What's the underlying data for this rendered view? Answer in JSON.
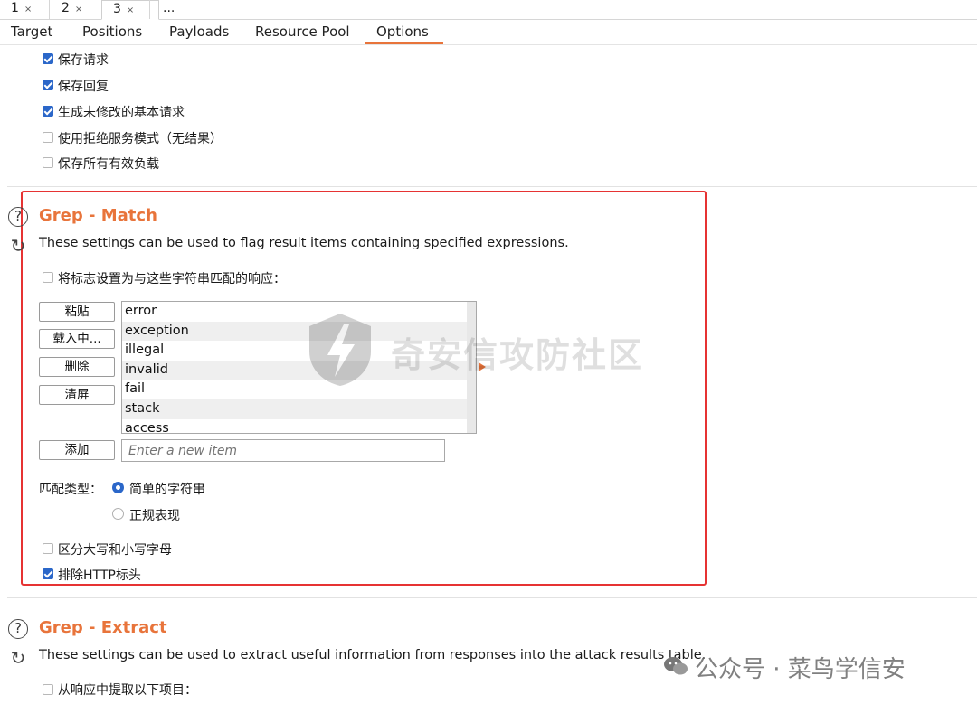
{
  "attack_tabs": [
    {
      "label": "1",
      "close": "×"
    },
    {
      "label": "2",
      "close": "×"
    },
    {
      "label": "3",
      "close": "×"
    },
    {
      "label": "..."
    }
  ],
  "sub_tabs": [
    "Target",
    "Positions",
    "Payloads",
    "Resource Pool",
    "Options"
  ],
  "active_sub_tab": "Options",
  "results_options": [
    {
      "label": "保存请求",
      "checked": true
    },
    {
      "label": "保存回复",
      "checked": true
    },
    {
      "label": "生成未修改的基本请求",
      "checked": true
    },
    {
      "label": "使用拒绝服务模式（无结果）",
      "checked": false
    },
    {
      "label": "保存所有有效负载",
      "checked": false
    }
  ],
  "grep_match": {
    "title": "Grep - Match",
    "description": "These settings can be used to flag result items containing specified expressions.",
    "flag_checkbox": {
      "label": "将标志设置为与这些字符串匹配的响应：",
      "checked": false
    },
    "buttons": {
      "paste": "粘贴",
      "load": "载入中...",
      "remove": "删除",
      "clear": "清屏",
      "add": "添加"
    },
    "items": [
      "error",
      "exception",
      "illegal",
      "invalid",
      "fail",
      "stack",
      "access"
    ],
    "new_item_placeholder": "Enter a new item",
    "match_type_label": "匹配类型：",
    "match_types": [
      {
        "label": "简单的字符串",
        "selected": true
      },
      {
        "label": "正规表现",
        "selected": false
      }
    ],
    "case_sensitive": {
      "label": "区分大写和小写字母",
      "checked": false
    },
    "exclude_headers": {
      "label": "排除HTTP标头",
      "checked": true
    }
  },
  "grep_extract": {
    "title": "Grep - Extract",
    "description": "These settings can be used to extract useful information from responses into the attack results table.",
    "extract_checkbox": {
      "label": "从响应中提取以下项目：",
      "checked": false
    }
  },
  "icons": {
    "help": "?",
    "refresh": "↻",
    "close": "×"
  },
  "watermarks": {
    "center": "奇安信攻防社区",
    "corner": "公众号 · 菜鸟学信安"
  },
  "colors": {
    "accent": "#e8743b",
    "highlight_box": "#e63333",
    "checkbox": "#2b67c9"
  }
}
